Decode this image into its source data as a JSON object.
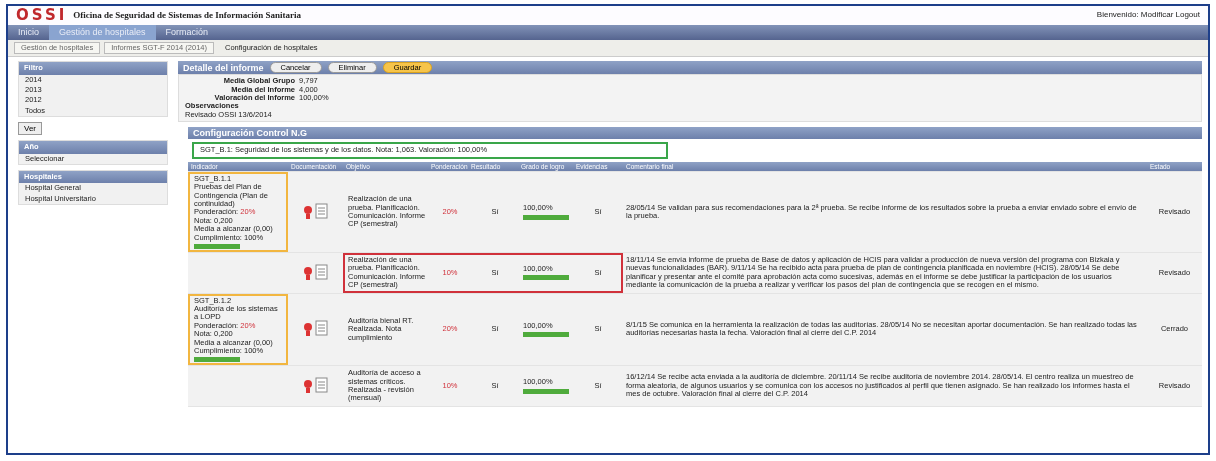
{
  "header": {
    "logo": "OSSI",
    "title": "Oficina de Seguridad de Sistemas de Información Sanitaria",
    "user": "Bienvenido: Modificar Logout"
  },
  "nav": [
    {
      "label": "Inicio",
      "selected": false
    },
    {
      "label": "Gestión de hospitales",
      "selected": true
    },
    {
      "label": "Formación",
      "selected": false
    }
  ],
  "breadcrumbs": [
    {
      "label": "Gestión de hospitales",
      "selected": false
    },
    {
      "label": "Informes SGT-F 2014 (2014)",
      "selected": false
    },
    {
      "label": "Configuración de hospitales",
      "selected": true
    }
  ],
  "sidebar": {
    "panels": [
      {
        "title": "Filtro",
        "items": [
          "2014",
          "2013",
          "2012",
          "Todos"
        ]
      },
      {
        "title": "Año",
        "items": [
          "Seleccionar"
        ]
      },
      {
        "title": "Hospitales",
        "items": [
          "Hospital General",
          "Hospital Universitario"
        ]
      }
    ],
    "button": "Ver"
  },
  "detail": {
    "title": "Detalle del informe",
    "buttons": [
      {
        "label": "Cancelar",
        "kind": "plain"
      },
      {
        "label": "Eliminar",
        "kind": "plain"
      },
      {
        "label": "Guardar",
        "kind": "primary"
      }
    ],
    "fields": [
      {
        "label": "Media Global Grupo",
        "value": "9,797"
      },
      {
        "label": "Media del Informe",
        "value": "4,000"
      },
      {
        "label": "Valoración del Informe",
        "value": "100,00%"
      }
    ],
    "observations": {
      "label": "Observaciones",
      "value": "Revisado OSSI 13/6/2014"
    }
  },
  "section": {
    "title": "Configuración Control N.G",
    "summary": {
      "text": "SGT_B.1: Seguridad de los sistemas y de los datos. Nota: 1,063. Valoración: 100,00%",
      "highlighted": true
    },
    "columns": [
      "Indicador",
      "Documentación",
      "Objetivo",
      "Ponderación",
      "Resultado",
      "Grado de logro",
      "Evidencias",
      "Comentario final",
      "Estado"
    ],
    "rows": [
      {
        "indicator": {
          "code": "SGT_B.1.1",
          "name": "Pruebas del Plan de Contingencia (Plan de continuidad)",
          "weight_label": "Ponderación:",
          "weight": "20%",
          "note": "Nota: 0,200",
          "target": "Media a alcanzar (0,00)",
          "compliance": "Cumplimiento: 100%",
          "level": 1,
          "highlighted": true
        },
        "objective": "Realización de una prueba. Planificación. Comunicación. Informe CP (semestral)",
        "weight": "20%",
        "result": "Sí",
        "grade": {
          "text": "100,00%",
          "level": 1
        },
        "evidence": "Sí",
        "comment": "28/05/14 Se validan para sus recomendaciones para la 2ª prueba. Se recibe informe de los resultados sobre la prueba a enviar enviado sobre el envío de la prueba.",
        "status": "Revisado",
        "highlighted": false
      },
      {
        "indicator": null,
        "objective": "Realización de una prueba. Planificación. Comunicación. Informe CP (semestral)",
        "weight": "10%",
        "result": "Sí",
        "grade": {
          "text": "100,00%",
          "level": 1
        },
        "evidence": "Sí",
        "comment": "18/11/14 Se envía informe de prueba de Base de datos y aplicación de HCIS para validar a producción de nueva versión del programa con Bizkaia y nuevas funcionalidades (BAR). 9/11/14 Se ha recibido acta para prueba de plan de contingencia planificada en noviembre (HCIS). 28/05/14 Se debe planificar y presentar ante el comité para aprobación acta como sucesivas, además en el informe se debe justificar la participación de los usuarios mediante la comunicación de la prueba a realizar y verificar los pasos del plan de contingencia que se recogen en el mismo.",
        "status": "Revisado",
        "highlighted": true
      },
      {
        "indicator": {
          "code": "SGT_B.1.2",
          "name": "Auditoría de los sistemas a LOPD",
          "weight_label": "Ponderación:",
          "weight": "20%",
          "note": "Nota: 0,200",
          "target": "Media a alcanzar (0,00)",
          "compliance": "Cumplimiento: 100%",
          "level": 1,
          "highlighted": true
        },
        "objective": "Auditoría bienal RT. Realizada. Nota cumplimiento",
        "weight": "20%",
        "result": "Sí",
        "grade": {
          "text": "100,00%",
          "level": 1
        },
        "evidence": "Sí",
        "comment": "8/1/15 Se comunica en la herramienta la realización de todas las auditorías. 28/05/14 No se necesitan aportar documentación. Se han realizado todas las auditorías necesarias hasta la fecha. Valoración final al cierre del C.P. 2014",
        "status": "Cerrado",
        "highlighted": false
      },
      {
        "indicator": null,
        "objective": "Auditoría de acceso a sistemas críticos. Realizada - revisión (mensual)",
        "weight": "10%",
        "result": "Sí",
        "grade": {
          "text": "100,00%",
          "level": 1
        },
        "evidence": "Sí",
        "comment": "16/12/14 Se recibe acta enviada a la auditoría de diciembre. 20/11/14 Se recibe auditoría de noviembre 2014. 28/05/14. El centro realiza un muestreo de forma aleatoria, de algunos usuarios y se comunica con los accesos no justificados al perfil que tienen asignado. Se han realizado los informes hasta el mes de octubre. Valoración final al cierre del C.P. 2014",
        "status": "Revisado",
        "highlighted": false
      }
    ]
  }
}
